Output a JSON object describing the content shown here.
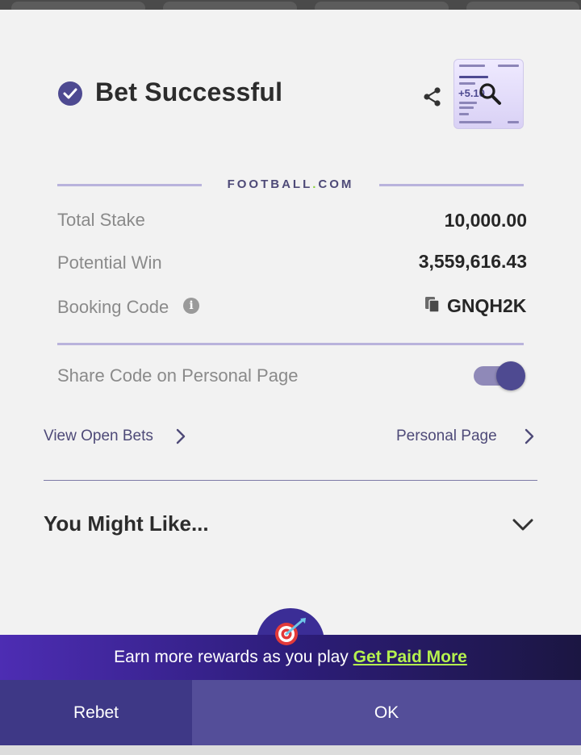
{
  "header": {
    "title": "Bet Successful"
  },
  "brand": {
    "name_left": "FOOTBALL",
    "name_dot": ".",
    "name_right": "COM"
  },
  "summary": {
    "total_stake_label": "Total Stake",
    "total_stake_value": "10,000.00",
    "potential_win_label": "Potential Win",
    "potential_win_value": "3,559,616.43",
    "booking_code_label": "Booking Code",
    "booking_code_value": "GNQH2K"
  },
  "share_setting": {
    "label": "Share Code on Personal Page",
    "enabled": true
  },
  "links": {
    "view_open_bets": "View Open Bets",
    "personal_page": "Personal Page"
  },
  "suggestions": {
    "heading": "You Might Like..."
  },
  "promo": {
    "text": "Earn more rewards as you play ",
    "link": "Get Paid More"
  },
  "actions": {
    "rebet": "Rebet",
    "ok": "OK"
  },
  "thumbnail": {
    "amount_preview": "+5.10"
  },
  "colors": {
    "accent": "#4e4a91",
    "promo_link": "#b5f14f",
    "ok_button": "#544e99",
    "rebet_button": "#3e3886"
  },
  "icons": [
    "check-circle-icon",
    "share-icon",
    "magnifier-icon",
    "info-icon",
    "copy-icon",
    "chevron-right-icon",
    "chevron-down-icon",
    "target-icon"
  ]
}
